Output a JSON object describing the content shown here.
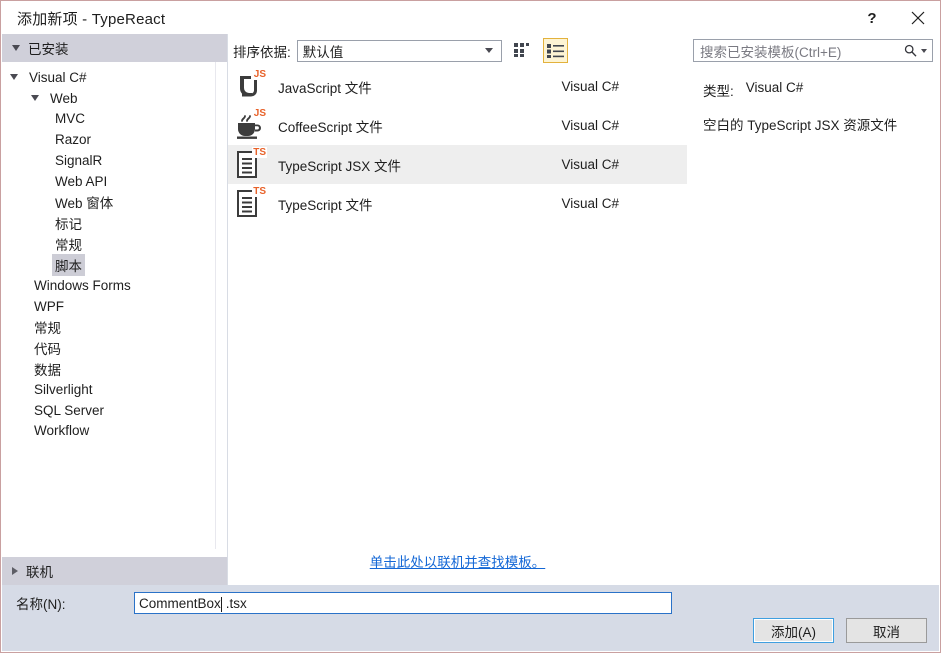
{
  "window": {
    "title": "添加新项 - TypeReact",
    "help_icon": "question-mark-icon",
    "close_icon": "close-icon"
  },
  "sidebar": {
    "installed_header": "已安装",
    "online_header": "联机",
    "tree": [
      {
        "label": "Visual C#",
        "indent": 0,
        "expander": "down",
        "selected": false
      },
      {
        "label": "Web",
        "indent": 1,
        "expander": "down",
        "selected": false
      },
      {
        "label": "MVC",
        "indent": 2,
        "expander": "none",
        "selected": false
      },
      {
        "label": "Razor",
        "indent": 2,
        "expander": "none",
        "selected": false
      },
      {
        "label": "SignalR",
        "indent": 2,
        "expander": "none",
        "selected": false
      },
      {
        "label": "Web API",
        "indent": 2,
        "expander": "none",
        "selected": false
      },
      {
        "label": "Web 窗体",
        "indent": 2,
        "expander": "none",
        "selected": false
      },
      {
        "label": "标记",
        "indent": 2,
        "expander": "none",
        "selected": false
      },
      {
        "label": "常规",
        "indent": 2,
        "expander": "none",
        "selected": false
      },
      {
        "label": "脚本",
        "indent": 2,
        "expander": "none",
        "selected": true
      },
      {
        "label": "Windows Forms",
        "indent": 1,
        "expander": "none",
        "selected": false
      },
      {
        "label": "WPF",
        "indent": 1,
        "expander": "none",
        "selected": false
      },
      {
        "label": "常规",
        "indent": 1,
        "expander": "none",
        "selected": false
      },
      {
        "label": "代码",
        "indent": 1,
        "expander": "none",
        "selected": false
      },
      {
        "label": "数据",
        "indent": 1,
        "expander": "none",
        "selected": false
      },
      {
        "label": "Silverlight",
        "indent": 1,
        "expander": "none",
        "selected": false
      },
      {
        "label": "SQL Server",
        "indent": 1,
        "expander": "none",
        "selected": false
      },
      {
        "label": "Workflow",
        "indent": 1,
        "expander": "none",
        "selected": false
      }
    ]
  },
  "toolbar": {
    "sort_label": "排序依据:",
    "sort_value": "默认值",
    "grid_view_icon": "small-icons-view-icon",
    "list_view_icon": "list-view-icon",
    "list_view_selected": true
  },
  "templates": {
    "items": [
      {
        "name": "JavaScript 文件",
        "language": "Visual C#",
        "icon": "javascript-file-icon",
        "badge": "JS",
        "selected": false
      },
      {
        "name": "CoffeeScript 文件",
        "language": "Visual C#",
        "icon": "coffeescript-file-icon",
        "badge": "JS",
        "selected": false
      },
      {
        "name": "TypeScript JSX 文件",
        "language": "Visual C#",
        "icon": "typescript-jsx-file-icon",
        "badge": "TS",
        "selected": true
      },
      {
        "name": "TypeScript 文件",
        "language": "Visual C#",
        "icon": "typescript-file-icon",
        "badge": "TS",
        "selected": false
      }
    ],
    "online_link": "单击此处以联机并查找模板。"
  },
  "search": {
    "placeholder": "搜索已安装模板(Ctrl+E)",
    "icon": "search-icon",
    "dropdown_icon": "chevron-down-icon"
  },
  "details": {
    "type_key": "类型:",
    "type_value": "Visual C#",
    "description": "空白的 TypeScript JSX 资源文件"
  },
  "footer": {
    "name_label": "名称(N):",
    "name_value_before_caret": "CommentBox",
    "name_value_after_caret": ".tsx",
    "add_button": "添加(A)",
    "cancel_button": "取消"
  },
  "colors": {
    "dialog_border": "#c9a0a0",
    "header_band": "#d0d0da",
    "footer_bg": "#d6dbe6",
    "selection": "#eeeeee",
    "link": "#1367d6",
    "accent_orange": "#e8622a",
    "default_button_border": "#3f9fe0"
  }
}
